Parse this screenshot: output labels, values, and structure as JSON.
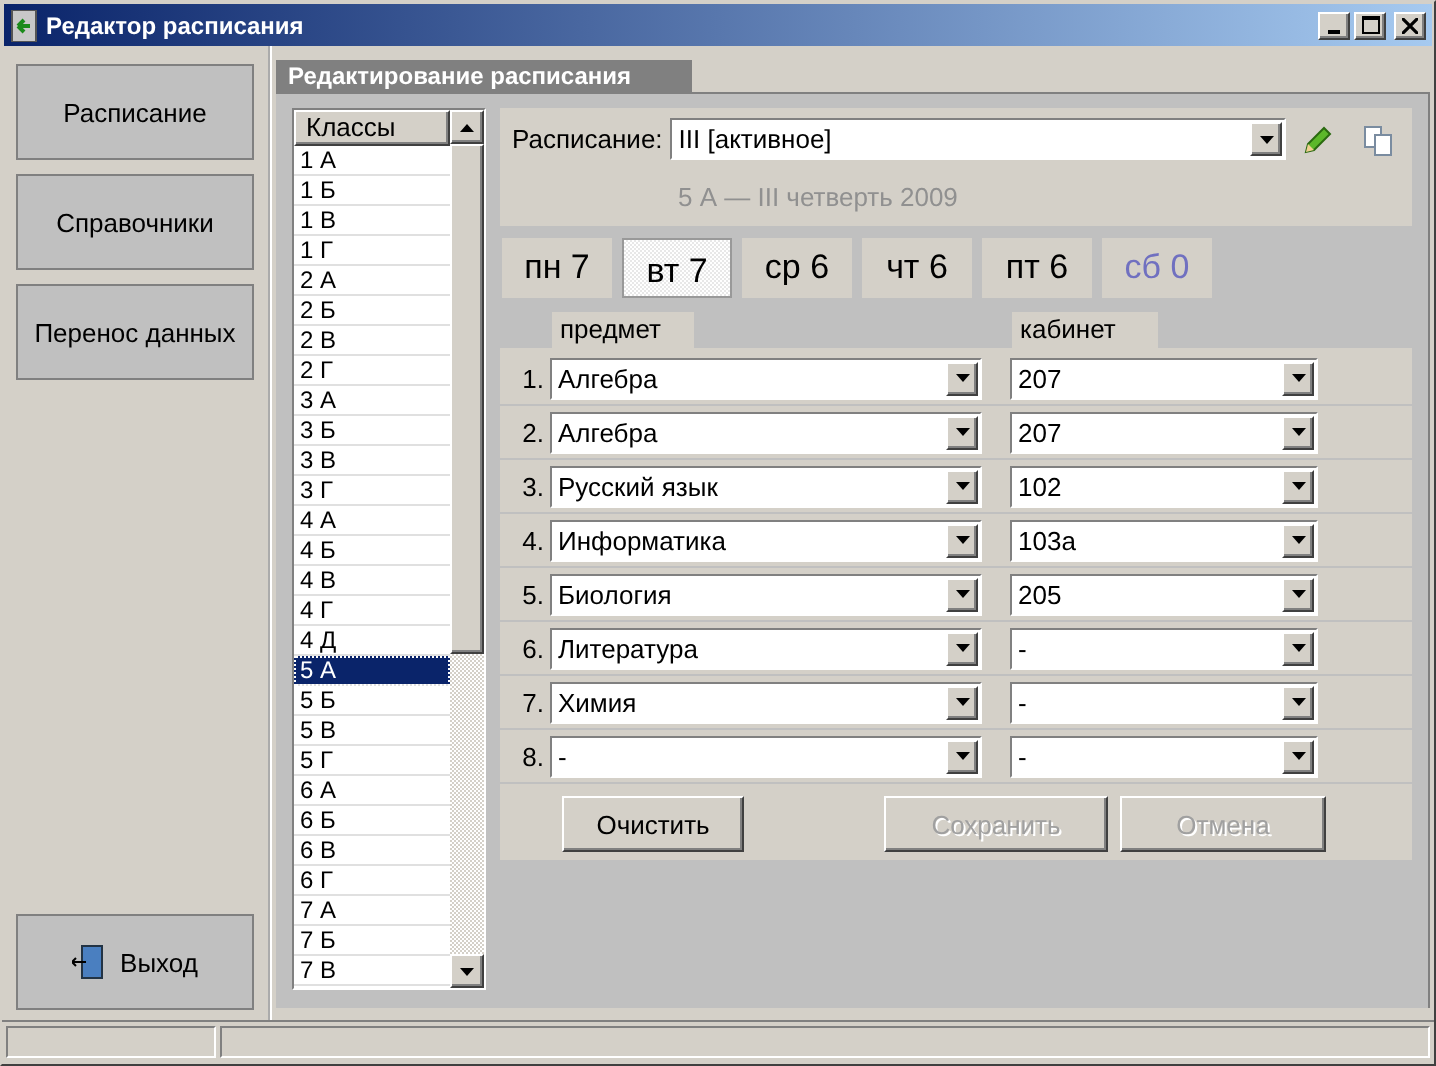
{
  "window": {
    "title": "Редактор расписания"
  },
  "nav": [
    {
      "label": "Расписание"
    },
    {
      "label": "Справочники"
    },
    {
      "label": "Перенос данных"
    }
  ],
  "exit_button": {
    "label": "Выход"
  },
  "panel": {
    "title": "Редактирование расписания"
  },
  "classes": {
    "header": "Классы",
    "items": [
      {
        "label": "1 А",
        "selected": false
      },
      {
        "label": "1 Б",
        "selected": false
      },
      {
        "label": "1 В",
        "selected": false
      },
      {
        "label": "1 Г",
        "selected": false
      },
      {
        "label": "2 А",
        "selected": false
      },
      {
        "label": "2 Б",
        "selected": false
      },
      {
        "label": "2 В",
        "selected": false
      },
      {
        "label": "2 Г",
        "selected": false
      },
      {
        "label": "3 А",
        "selected": false
      },
      {
        "label": "3 Б",
        "selected": false
      },
      {
        "label": "3 В",
        "selected": false
      },
      {
        "label": "3 Г",
        "selected": false
      },
      {
        "label": "4 А",
        "selected": false
      },
      {
        "label": "4 Б",
        "selected": false
      },
      {
        "label": "4 В",
        "selected": false
      },
      {
        "label": "4 Г",
        "selected": false
      },
      {
        "label": "4 Д",
        "selected": false
      },
      {
        "label": "5 А",
        "selected": true
      },
      {
        "label": "5 Б",
        "selected": false
      },
      {
        "label": "5 В",
        "selected": false
      },
      {
        "label": "5 Г",
        "selected": false
      },
      {
        "label": "6 А",
        "selected": false
      },
      {
        "label": "6 Б",
        "selected": false
      },
      {
        "label": "6 В",
        "selected": false
      },
      {
        "label": "6 Г",
        "selected": false
      },
      {
        "label": "7 А",
        "selected": false
      },
      {
        "label": "7 Б",
        "selected": false
      },
      {
        "label": "7 В",
        "selected": false
      }
    ]
  },
  "schedule": {
    "label": "Расписание:",
    "value": "III [активное]",
    "subtitle": "5 А — III четверть 2009"
  },
  "days": [
    {
      "label": "пн 7",
      "selected": false,
      "disabled": false
    },
    {
      "label": "вт 7",
      "selected": true,
      "disabled": false
    },
    {
      "label": "ср 6",
      "selected": false,
      "disabled": false
    },
    {
      "label": "чт 6",
      "selected": false,
      "disabled": false
    },
    {
      "label": "пт 6",
      "selected": false,
      "disabled": false
    },
    {
      "label": "сб 0",
      "selected": false,
      "disabled": true
    }
  ],
  "lessons": {
    "columns": [
      "предмет",
      "кабинет"
    ],
    "rows": [
      {
        "number": "1.",
        "subject": "Алгебра",
        "room": "207"
      },
      {
        "number": "2.",
        "subject": "Алгебра",
        "room": "207"
      },
      {
        "number": "3.",
        "subject": "Русский язык",
        "room": "102"
      },
      {
        "number": "4.",
        "subject": "Информатика",
        "room": "103а"
      },
      {
        "number": "5.",
        "subject": "Биология",
        "room": "205"
      },
      {
        "number": "6.",
        "subject": "Литература",
        "room": "-"
      },
      {
        "number": "7.",
        "subject": "Химия",
        "room": "-"
      },
      {
        "number": "8.",
        "subject": "-",
        "room": "-"
      }
    ]
  },
  "buttons": [
    {
      "label": "Очистить",
      "disabled": false
    },
    {
      "label": "Сохранить",
      "disabled": true
    },
    {
      "label": "Отмена",
      "disabled": true
    }
  ]
}
